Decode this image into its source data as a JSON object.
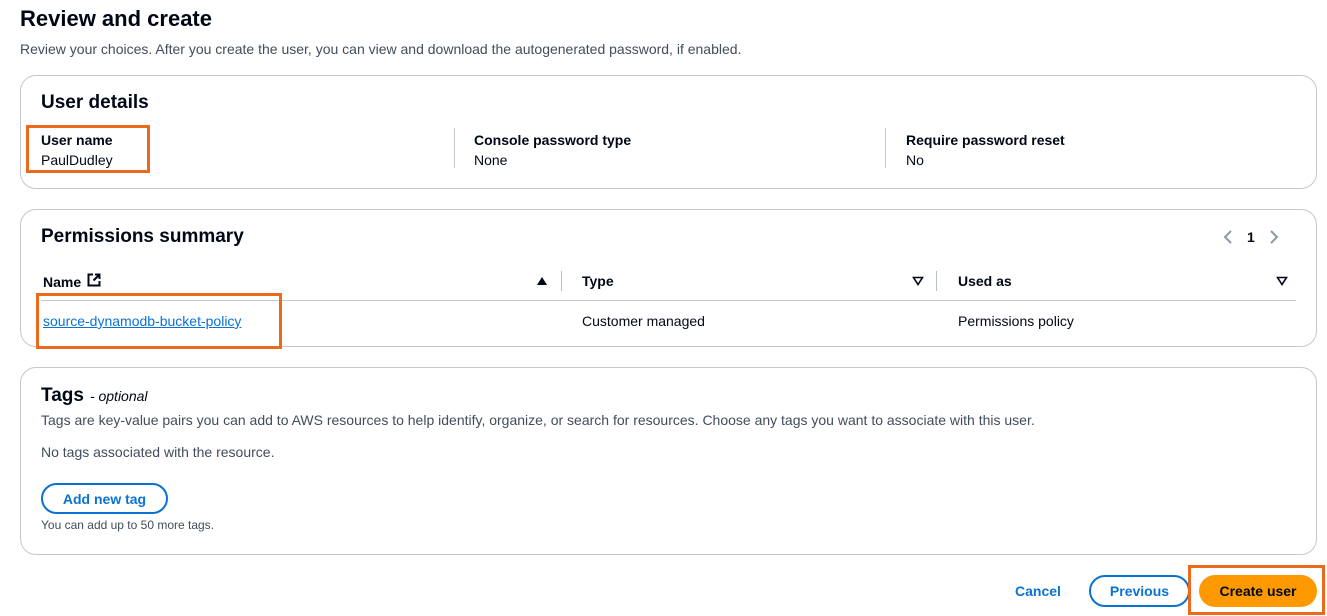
{
  "page": {
    "title": "Review and create",
    "description": "Review your choices. After you create the user, you can view and download the autogenerated password, if enabled."
  },
  "user_details": {
    "title": "User details",
    "fields": [
      {
        "label": "User name",
        "value": "PaulDudley"
      },
      {
        "label": "Console password type",
        "value": "None"
      },
      {
        "label": "Require password reset",
        "value": "No"
      }
    ]
  },
  "permissions": {
    "title": "Permissions summary",
    "page_number": "1",
    "columns": [
      {
        "label": "Name"
      },
      {
        "label": "Type"
      },
      {
        "label": "Used as"
      }
    ],
    "rows": [
      {
        "name": "source-dynamodb-bucket-policy",
        "type": "Customer managed",
        "used_as": "Permissions policy"
      }
    ]
  },
  "tags": {
    "title": "Tags",
    "optional": "- optional",
    "description": "Tags are key-value pairs you can add to AWS resources to help identify, organize, or search for resources. Choose any tags you want to associate with this user.",
    "empty_text": "No tags associated with the resource.",
    "add_button": "Add new tag",
    "hint": "You can add up to 50 more tags."
  },
  "footer": {
    "cancel": "Cancel",
    "previous": "Previous",
    "create": "Create user"
  },
  "colors": {
    "accent": "#0972d3",
    "primary_button": "#ff9900",
    "highlight": "#ec6a1e"
  }
}
